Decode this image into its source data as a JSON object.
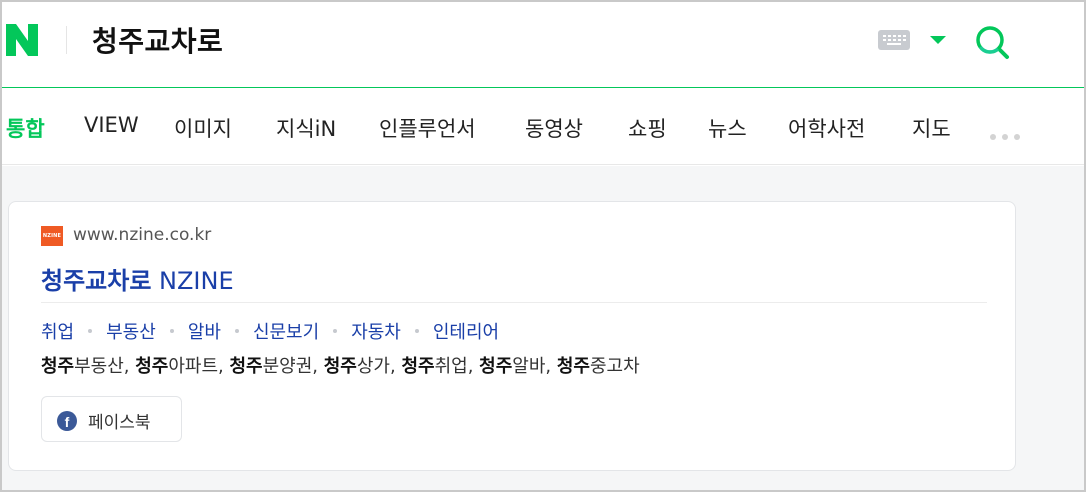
{
  "header": {
    "query": "청주교차로",
    "colors": {
      "brand": "#03c75a"
    }
  },
  "tabs": [
    {
      "label": "통합",
      "active": true
    },
    {
      "label": "VIEW"
    },
    {
      "label": "이미지"
    },
    {
      "label": "지식iN"
    },
    {
      "label": "인플루언서"
    },
    {
      "label": "동영상"
    },
    {
      "label": "쇼핑"
    },
    {
      "label": "뉴스"
    },
    {
      "label": "어학사전"
    },
    {
      "label": "지도"
    }
  ],
  "result": {
    "favicon_text": "NZINE",
    "url": "www.nzine.co.kr",
    "title_bold": "청주교차로",
    "title_rest": " NZINE",
    "sitelinks": [
      "취업",
      "부동산",
      "알바",
      "신문보기",
      "자동차",
      "인테리어"
    ],
    "keywords": [
      {
        "bold": "청주",
        "rest": "부동산, "
      },
      {
        "bold": "청주",
        "rest": "아파트, "
      },
      {
        "bold": "청주",
        "rest": "분양권, "
      },
      {
        "bold": "청주",
        "rest": "상가, "
      },
      {
        "bold": "청주",
        "rest": "취업, "
      },
      {
        "bold": "청주",
        "rest": "알바, "
      },
      {
        "bold": "청주",
        "rest": "중고차"
      }
    ],
    "share_label": "페이스북"
  },
  "icons": {
    "logo": "naver-logo-icon",
    "keyboard": "keyboard-icon",
    "dropdown": "caret-down-icon",
    "search": "search-icon",
    "more": "more-dots-icon",
    "facebook": "facebook-icon"
  }
}
